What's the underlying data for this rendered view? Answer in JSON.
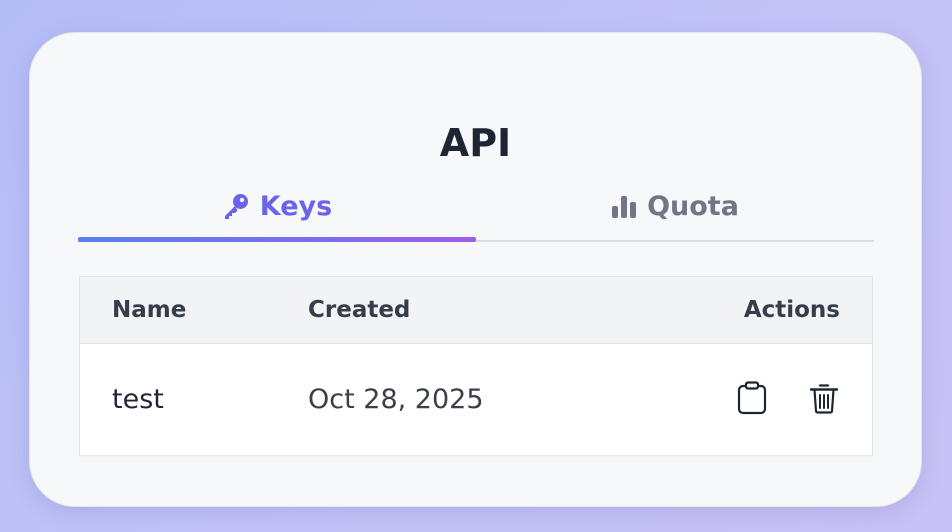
{
  "card": {
    "title": "API"
  },
  "tabs": [
    {
      "label": "Keys",
      "icon": "key-icon",
      "active": true
    },
    {
      "label": "Quota",
      "icon": "bar-chart-icon",
      "active": false
    }
  ],
  "table": {
    "columns": [
      "Name",
      "Created",
      "Actions"
    ],
    "rows": [
      {
        "name": "test",
        "created": "Oct 28, 2025",
        "actions": [
          "clipboard-icon",
          "trash-icon"
        ]
      }
    ]
  },
  "colors": {
    "accent": "#6b63e8",
    "tab_inactive": "#707683",
    "heading": "#1f2633"
  }
}
